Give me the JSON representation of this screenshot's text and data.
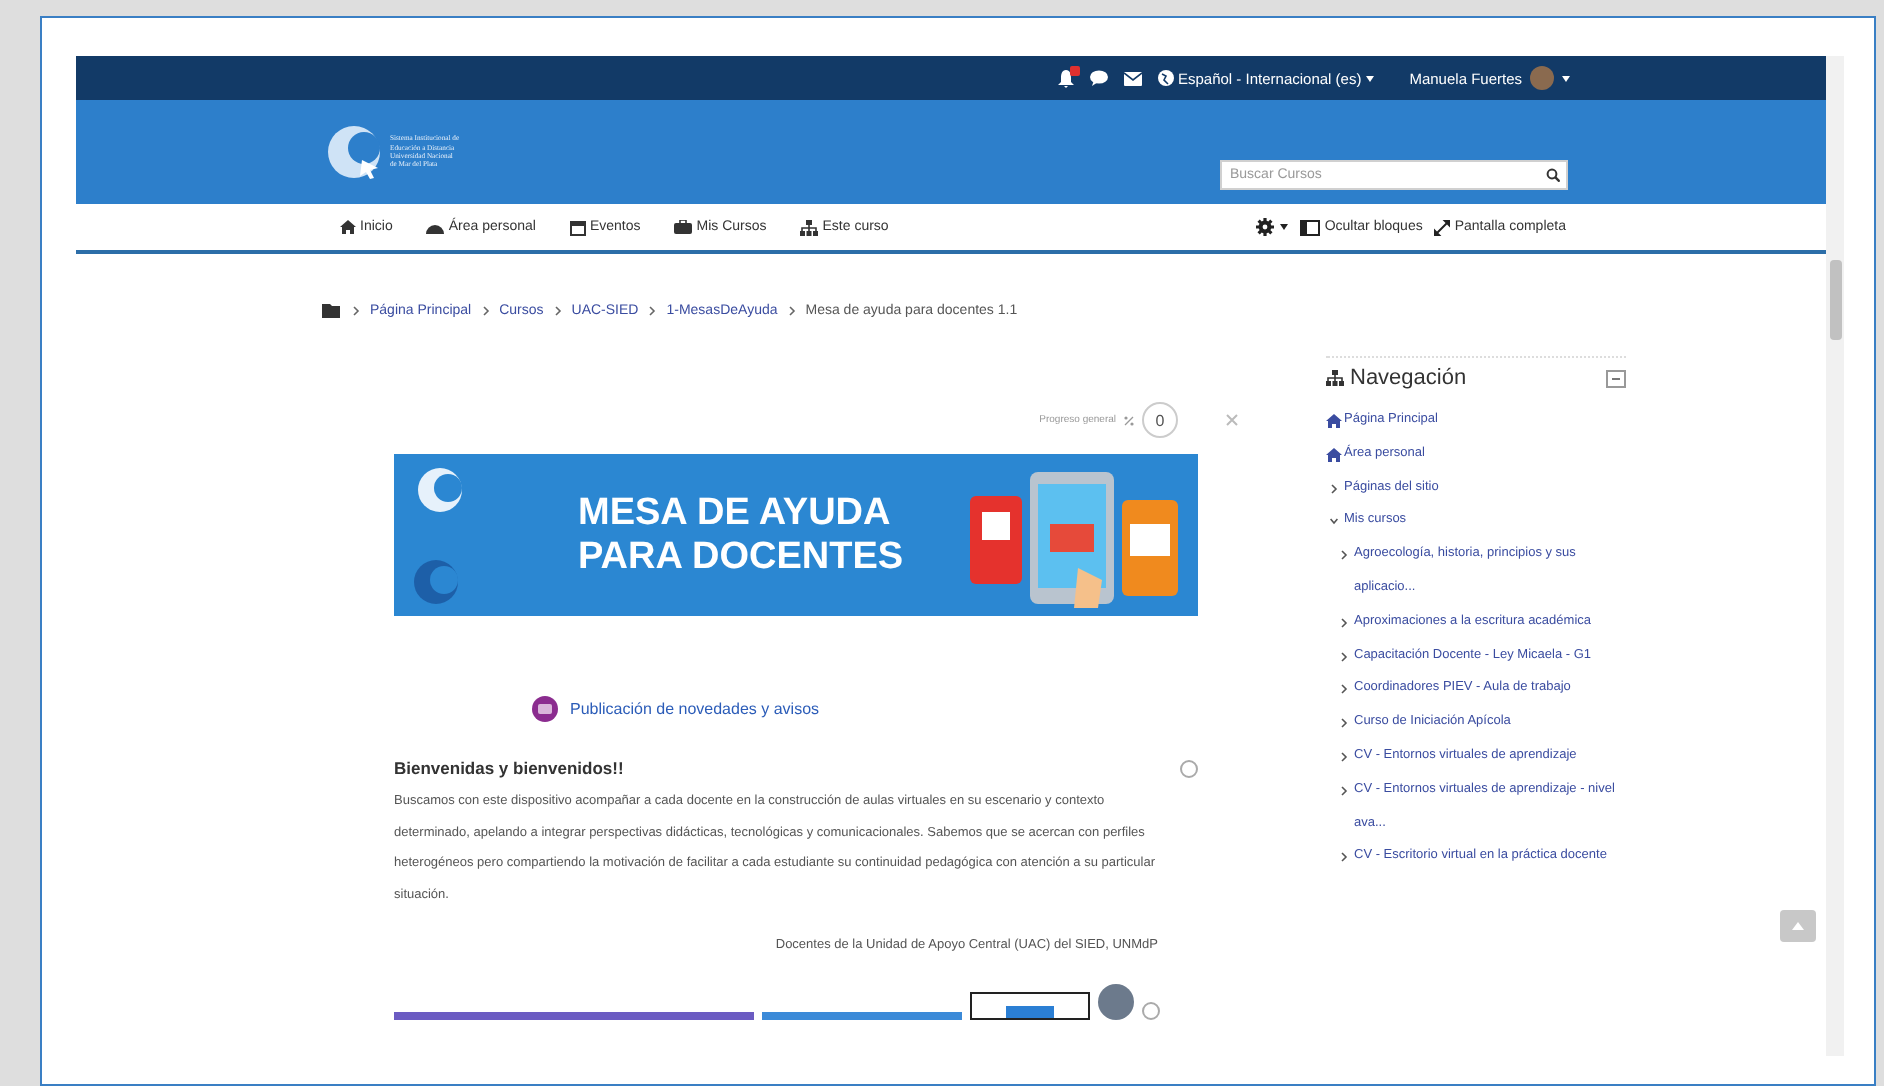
{
  "top_bar": {
    "notifications": {
      "badge": true
    },
    "language": "Español - Internacional (es)",
    "user": "Manuela Fuertes"
  },
  "header": {
    "logo_lines": [
      "Sistema Institucional de",
      "Educación a Distancia",
      "Universidad Nacional",
      "de Mar del Plata"
    ],
    "search": {
      "placeholder": "Buscar Cursos"
    }
  },
  "nav": {
    "items": [
      "Inicio",
      "Área personal",
      "Eventos",
      "Mis Cursos",
      "Este curso"
    ],
    "actions": [
      "Ocultar bloques",
      "Pantalla completa"
    ]
  },
  "breadcrumb": [
    "Página Principal",
    "Cursos",
    "UAC-SIED",
    "1-MesasDeAyuda",
    "Mesa de ayuda para docentes 1.1"
  ],
  "progress": {
    "label": "Progreso general",
    "value": "0"
  },
  "banner": {
    "title_lines": [
      "MESA DE AYUDA",
      "PARA DOCENTES"
    ]
  },
  "forum_link": "Publicación de novedades y avisos",
  "welcome": {
    "title": "Bienvenidas y bienvenidos!!",
    "checked": false,
    "body": "Buscamos con este dispositivo acompañar a cada docente en la construcción de aulas virtuales en su escenario y contexto determinado, apelando a integrar perspectivas didácticas, tecnológicas y comunicacionales. Sabemos que se acercan con perfiles heterogéneos pero compartiendo la motivación de facilitar a cada estudiante su continuidad pedagógica con atención a su particular situación.",
    "signature": "Docentes de la Unidad de Apoyo Central (UAC) del SIED, UNMdP"
  },
  "next_section": {
    "checked": false
  },
  "navigation_block": {
    "title": "Navegación",
    "items": [
      {
        "label": "Página Principal",
        "kind": "home"
      },
      {
        "label": "Área personal",
        "kind": "home"
      },
      {
        "label": "Páginas del sitio",
        "kind": "branch",
        "expanded": false
      },
      {
        "label": "Mis cursos",
        "kind": "branch",
        "expanded": true,
        "children": [
          {
            "label": "Agroecología, historia, principios y sus aplicacio...",
            "kind": "branch",
            "expanded": false
          },
          {
            "label": "Aproximaciones a la escritura académica",
            "kind": "branch",
            "expanded": false
          },
          {
            "label": "Capacitación Docente - Ley Micaela - G1",
            "kind": "branch",
            "expanded": false
          },
          {
            "label": "Coordinadores PIEV - Aula de trabajo",
            "kind": "branch",
            "expanded": false
          },
          {
            "label": "Curso de Iniciación Apícola",
            "kind": "branch",
            "expanded": false
          },
          {
            "label": "CV - Entornos virtuales de aprendizaje",
            "kind": "branch",
            "expanded": false
          },
          {
            "label": "CV - Entornos virtuales de aprendizaje - nivel ava...",
            "kind": "branch",
            "expanded": false
          },
          {
            "label": "CV - Escritorio virtual en la práctica docente",
            "kind": "branch",
            "expanded": false
          }
        ]
      }
    ]
  }
}
